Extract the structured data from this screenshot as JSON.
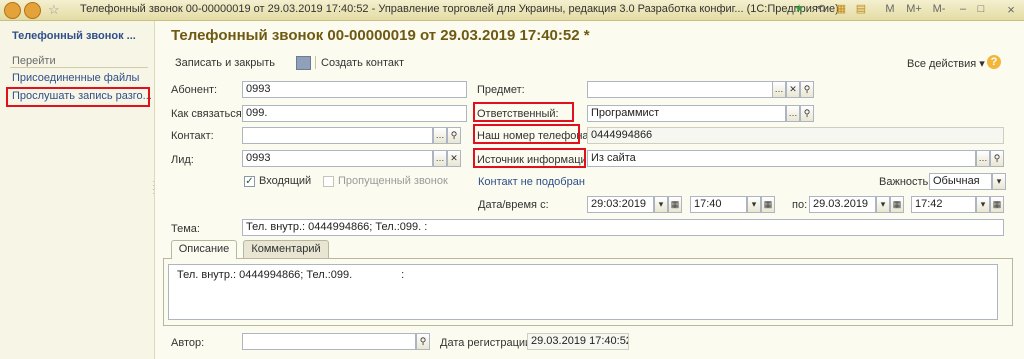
{
  "window": {
    "title": "Телефонный звонок 00-00000019 от 29.03.2019 17:40:52 - Управление торговлей для Украины, редакция 3.0 Разработка конфиг... (1С:Предприятие)",
    "buttons": [
      "M",
      "M+",
      "M-"
    ],
    "close": "×"
  },
  "sidebar": {
    "title": "Телефонный звонок ...",
    "group_label": "Перейти",
    "links": [
      "Присоединенные файлы",
      "Прослушать запись разго..."
    ]
  },
  "header": {
    "title": "Телефонный звонок 00-00000019 от 29.03.2019 17:40:52 *"
  },
  "toolbar": {
    "save_close": "Записать и закрыть",
    "create_contact": "Создать контакт",
    "all_actions": "Все действия ▾",
    "help": "?"
  },
  "form": {
    "abonent_label": "Абонент:",
    "abonent_value": "0993",
    "how_contact_label": "Как связаться:",
    "how_contact_value": "099.",
    "contact_label": "Контакт:",
    "contact_value": "",
    "lead_label": "Лид:",
    "lead_value": "0993",
    "incoming_label": "Входящий",
    "missed_label": "Пропущенный звонок",
    "subject_label": "Предмет:",
    "subject_value": "",
    "responsible_label": "Ответственный:",
    "responsible_value": "Программист",
    "our_phone_label": "Наш номер телефона:",
    "our_phone_value": "0444994866",
    "info_source_label": "Источник информации:",
    "info_source_value": "Из сайта",
    "contact_not_found": "Контакт не подобран",
    "importance_label": "Важность:",
    "importance_value": "Обычная",
    "datetime_label": "Дата/время с:",
    "date_from": "29:03:2019",
    "time_from": "17:40",
    "to_label": "по:",
    "date_to": "29.03.2019",
    "time_to": "17:42",
    "topic_label": "Тема:",
    "topic_value": "Тел. внутр.: 0444994866; Тел.:099.                  :",
    "author_label": "Автор:",
    "author_value": "",
    "reg_date_label": "Дата регистрации:",
    "reg_date_value": "29.03.2019 17:40:52"
  },
  "tabs": [
    "Описание",
    "Комментарий"
  ],
  "description": "Тел. внутр.: 0444994866; Тел.:099.                :",
  "icons": {
    "select": "…",
    "clear": "✕",
    "search": "⚲",
    "dropdown": "▾",
    "calendar": "▦",
    "check": "✓"
  }
}
